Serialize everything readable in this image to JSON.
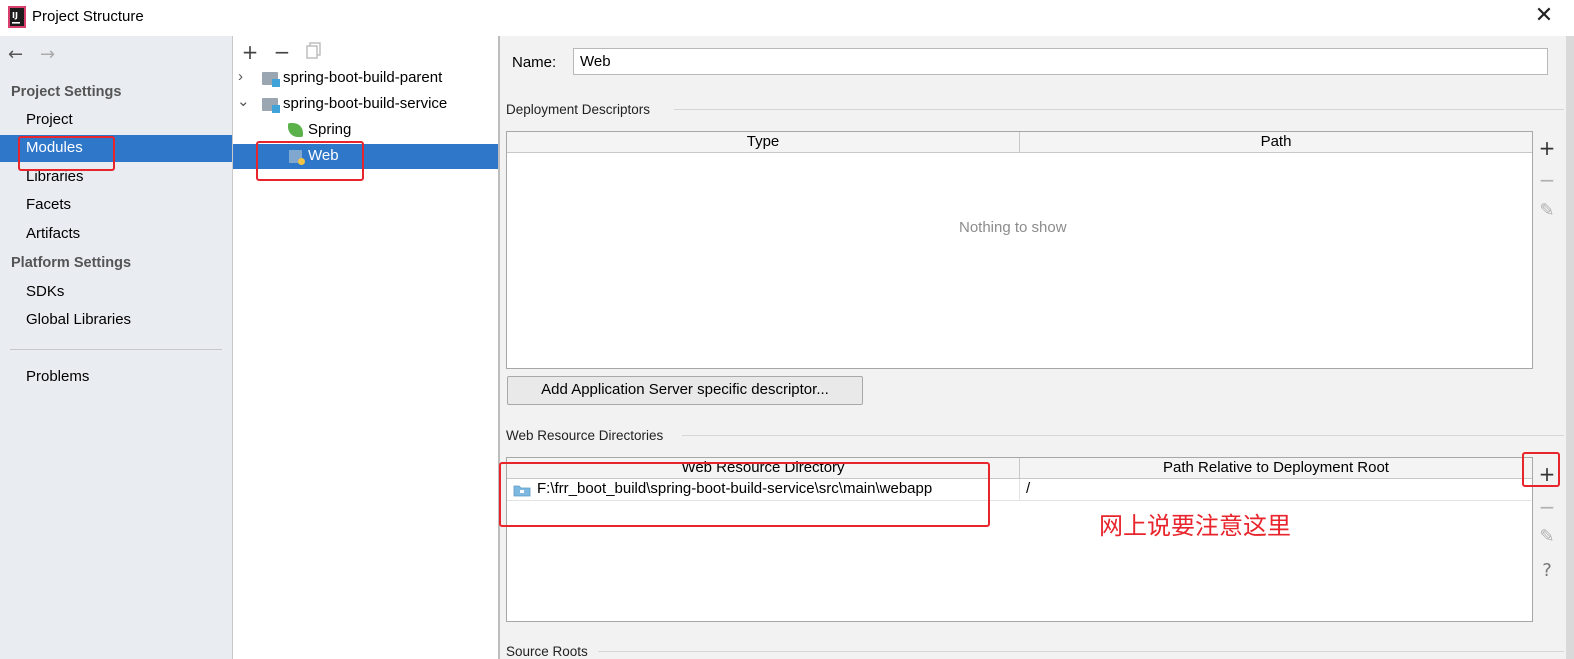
{
  "window": {
    "title": "Project Structure"
  },
  "sidebar": {
    "back_glyph": "←",
    "forward_glyph": "→",
    "project_settings_heading": "Project Settings",
    "project_items": [
      {
        "label": "Project",
        "selected": false
      },
      {
        "label": "Modules",
        "selected": true
      },
      {
        "label": "Libraries",
        "selected": false
      },
      {
        "label": "Facets",
        "selected": false
      },
      {
        "label": "Artifacts",
        "selected": false
      }
    ],
    "platform_settings_heading": "Platform Settings",
    "platform_items": [
      {
        "label": "SDKs"
      },
      {
        "label": "Global Libraries"
      }
    ],
    "problems_label": "Problems"
  },
  "tree": {
    "toolbar": {
      "add": "+",
      "remove": "−"
    },
    "nodes": [
      {
        "label": "spring-boot-build-parent",
        "expanded": false,
        "icon": "module-folder-icon"
      },
      {
        "label": "spring-boot-build-service",
        "expanded": true,
        "icon": "module-folder-icon"
      },
      {
        "label": "Spring",
        "icon": "spring-leaf-icon"
      },
      {
        "label": "Web",
        "icon": "web-facet-icon",
        "selected": true
      }
    ]
  },
  "main": {
    "name_label": "Name:",
    "name_value": "Web",
    "deployment_descriptors": {
      "title": "Deployment Descriptors",
      "columns": [
        "Type",
        "Path"
      ],
      "empty_text": "Nothing to show"
    },
    "descriptor_button": "Add Application Server specific descriptor...",
    "web_resource_directories": {
      "title": "Web Resource Directories",
      "columns": [
        "Web Resource Directory",
        "Path Relative to Deployment Root"
      ],
      "rows": [
        {
          "directory": "F:\\frr_boot_build\\spring-boot-build-service\\src\\main\\webapp",
          "path": "/"
        }
      ]
    },
    "source_roots_title": "Source Roots",
    "side_buttons": {
      "add": "+",
      "remove": "−",
      "edit": "✎",
      "help": "?"
    }
  },
  "annotation": {
    "note": "网上说要注意这里",
    "color": "#e8242c"
  },
  "colors": {
    "selection": "#2f77c9",
    "sidebar_bg": "#e9edf2"
  }
}
